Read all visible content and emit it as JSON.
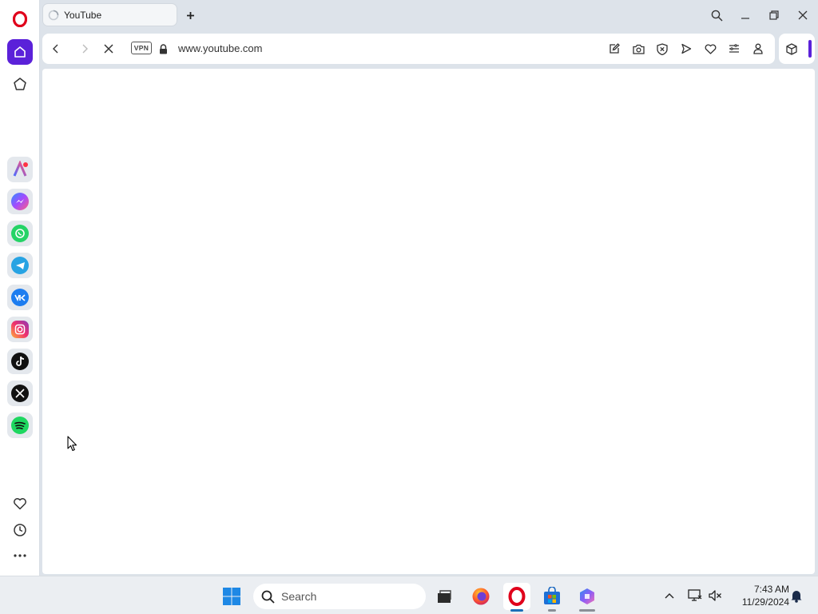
{
  "browser": {
    "tab": {
      "title": "YouTube"
    },
    "address_bar": {
      "url": "www.youtube.com",
      "vpn_label": "VPN"
    }
  },
  "sidebar": {
    "items": [
      {
        "name": "home",
        "icon": "home-icon",
        "active": true
      },
      {
        "name": "pinboard",
        "icon": "star-icon"
      }
    ],
    "apps": [
      {
        "name": "aria",
        "icon": "aria-icon"
      },
      {
        "name": "messenger",
        "icon": "messenger-icon"
      },
      {
        "name": "whatsapp",
        "icon": "whatsapp-icon"
      },
      {
        "name": "telegram",
        "icon": "telegram-icon"
      },
      {
        "name": "vk",
        "icon": "vk-icon"
      },
      {
        "name": "instagram",
        "icon": "instagram-icon"
      },
      {
        "name": "tiktok",
        "icon": "tiktok-icon"
      },
      {
        "name": "x",
        "icon": "x-icon"
      },
      {
        "name": "spotify",
        "icon": "spotify-icon"
      }
    ],
    "bottom": [
      {
        "name": "bookmarks",
        "icon": "heart-icon"
      },
      {
        "name": "history",
        "icon": "clock-icon"
      },
      {
        "name": "more",
        "icon": "more-icon"
      }
    ]
  },
  "taskbar": {
    "search_label": "Search",
    "time": "7:43 AM",
    "date": "11/29/2024",
    "apps": [
      "start",
      "search",
      "task-view",
      "firefox",
      "opera",
      "store",
      "copilot"
    ]
  },
  "colors": {
    "opera_red": "#e0001b",
    "sidebar_active": "#5b21d9",
    "window_bg": "#dde3ea"
  }
}
